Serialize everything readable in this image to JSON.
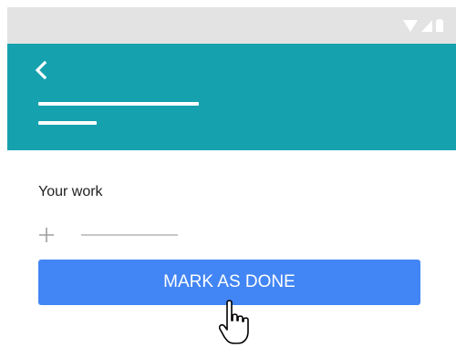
{
  "colors": {
    "status_bar": "#e3e3e3",
    "app_bar": "#16a1af",
    "primary_button": "#4285f4",
    "placeholder_line": "#c7c7c7"
  },
  "status_bar": {
    "icons": [
      "wifi-icon",
      "signal-icon",
      "battery-icon"
    ]
  },
  "app_bar": {
    "back_icon": "chevron-left-icon"
  },
  "content": {
    "section_label": "Your work",
    "add_icon": "plus-icon",
    "mark_done_label": "MARK AS DONE"
  },
  "pointer": {
    "icon": "hand-pointer-icon"
  }
}
